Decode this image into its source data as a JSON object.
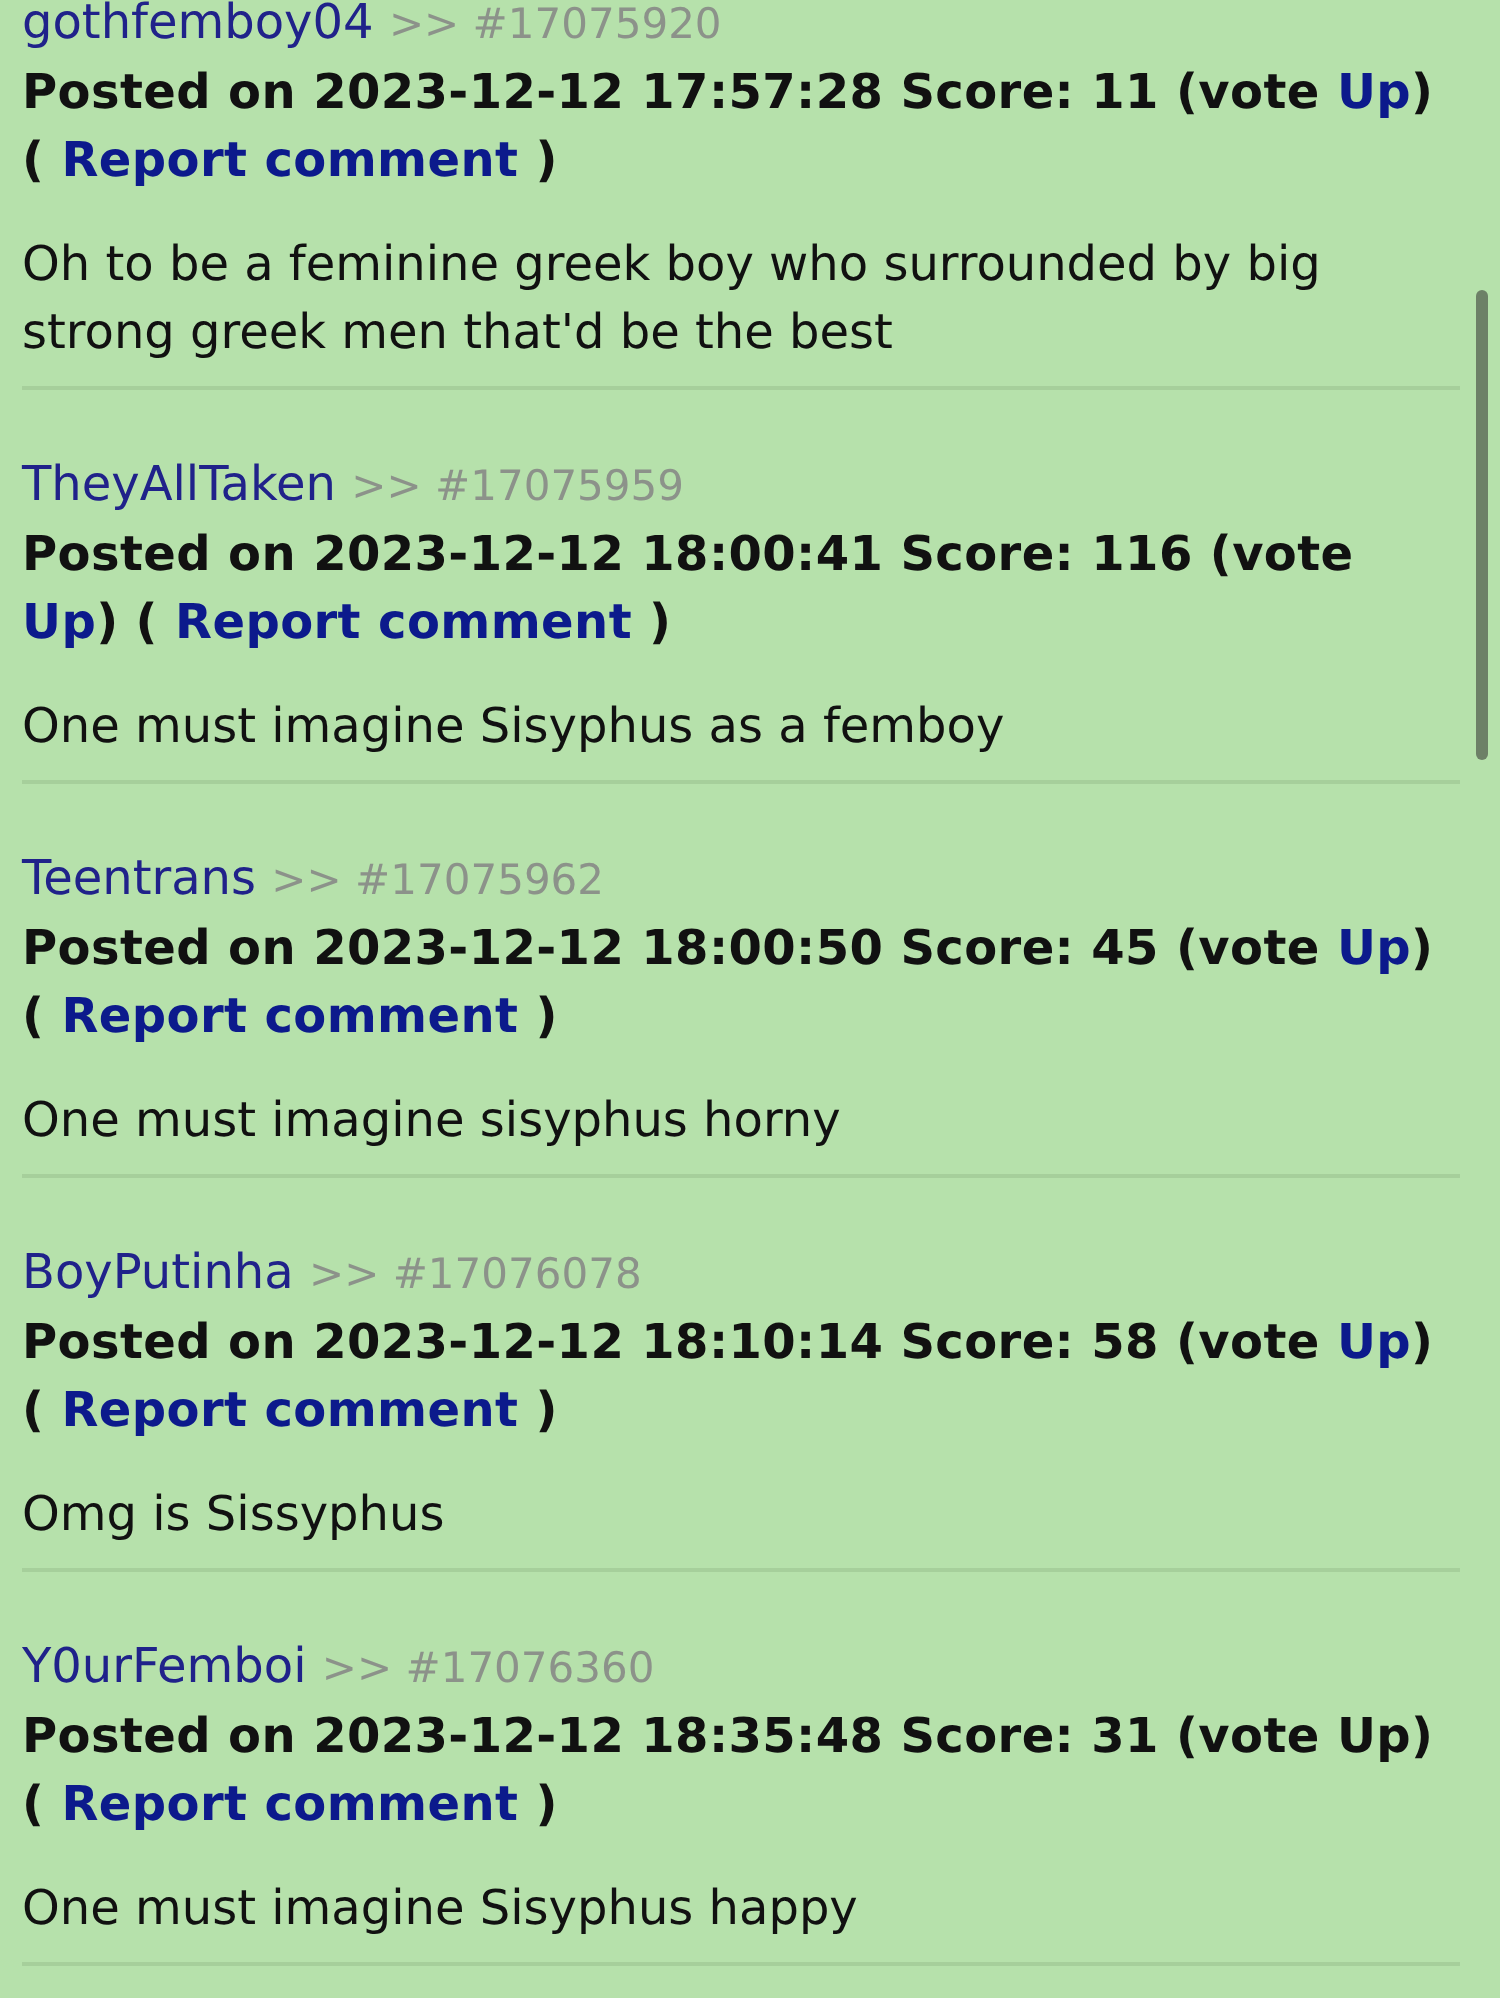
{
  "comments": [
    {
      "author": "gothfemboy04",
      "ref": ">> #17075920",
      "meta": "Posted on 2023-12-12 17:57:28 Score: 11 (vote",
      "vote_link": "Up",
      "voted": false,
      "between": ") (",
      "report_link": "Report comment",
      "closing": ")",
      "body": "Oh to be a feminine greek boy who surrounded by big strong greek men that'd be the best"
    },
    {
      "author": "TheyAllTaken",
      "ref": ">> #17075959",
      "meta": "Posted on 2023-12-12 18:00:41 Score: 116 (vote",
      "vote_link": "Up",
      "voted": false,
      "between": ") (",
      "report_link": "Report comment",
      "closing": ")",
      "body": "One must imagine Sisyphus as a femboy"
    },
    {
      "author": "Teentrans",
      "ref": ">> #17075962",
      "meta": "Posted on 2023-12-12 18:00:50 Score: 45 (vote",
      "vote_link": "Up",
      "voted": false,
      "between": ") (",
      "report_link": "Report comment",
      "closing": ")",
      "body": "One must imagine sisyphus horny"
    },
    {
      "author": "BoyPutinha",
      "ref": ">> #17076078",
      "meta": "Posted on 2023-12-12 18:10:14 Score: 58 (vote",
      "vote_link": "Up",
      "voted": false,
      "between": ") (",
      "report_link": "Report comment",
      "closing": ")",
      "body": "Omg is Sissyphus"
    },
    {
      "author": "Y0urFemboi",
      "ref": ">> #17076360",
      "meta": "Posted on 2023-12-12 18:35:48 Score: 31 (vote",
      "vote_link": "Up",
      "voted": true,
      "between": ") (",
      "report_link": "Report comment",
      "closing": ")",
      "body": "One must imagine Sisyphus happy"
    }
  ]
}
